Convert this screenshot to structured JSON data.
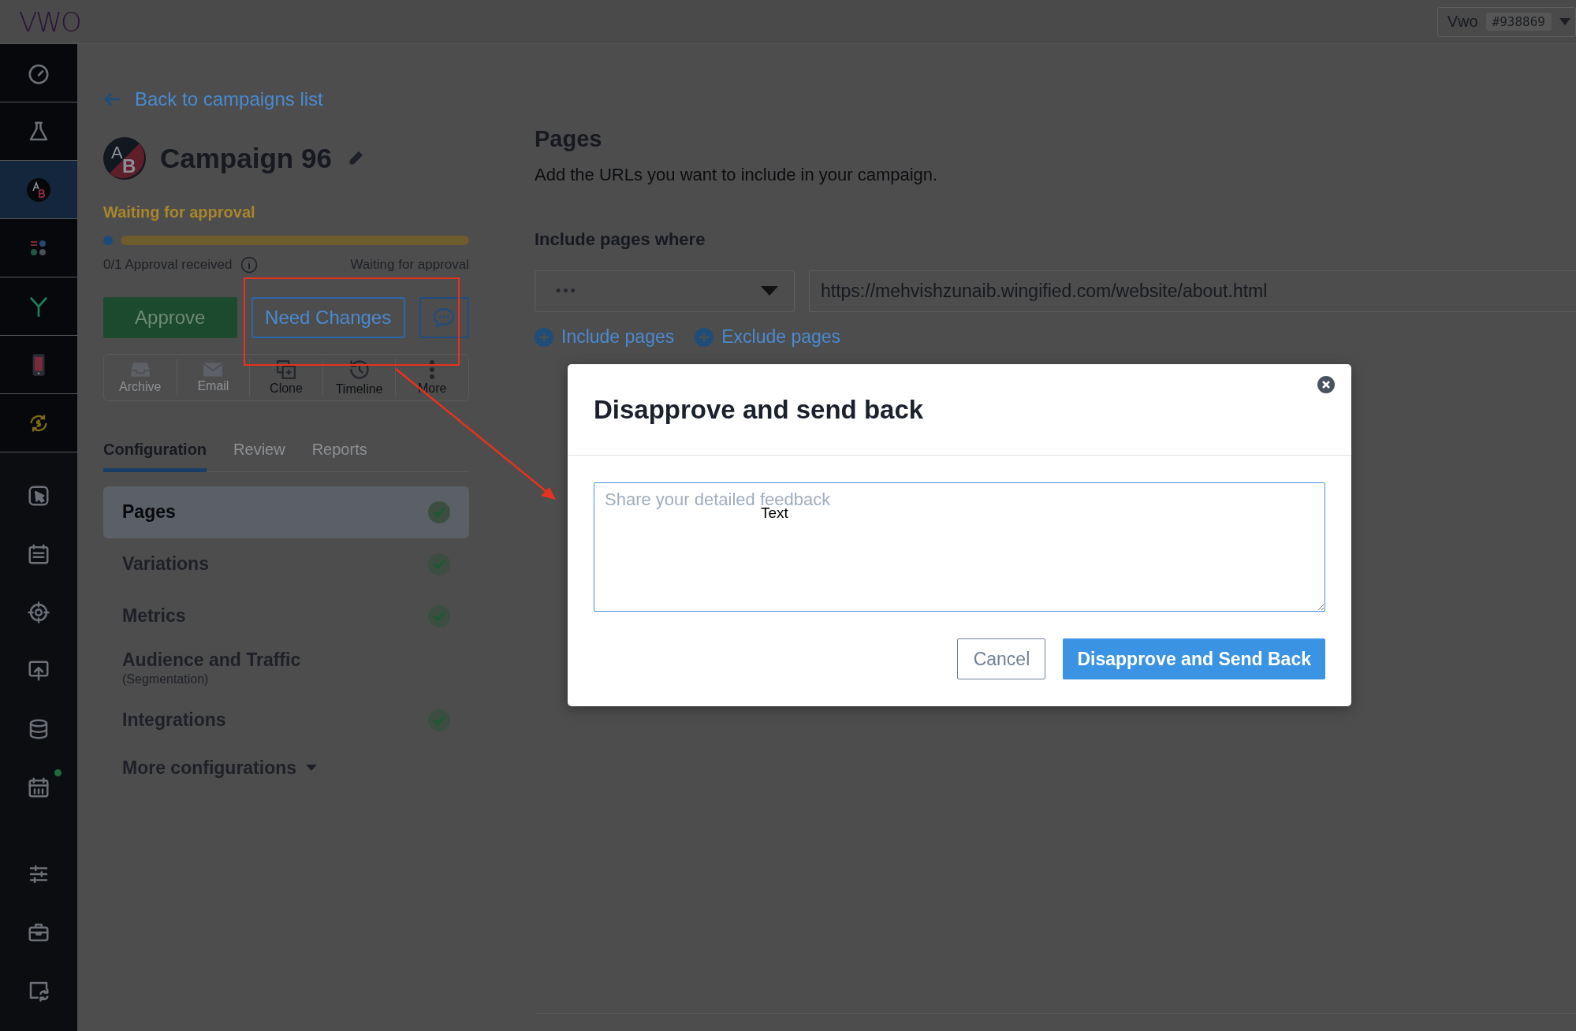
{
  "header": {
    "logo": "VWO",
    "account": {
      "name": "Vwo",
      "id": "#938869"
    }
  },
  "sidebar": {
    "items": [
      {
        "selected": false,
        "notification": false
      },
      {
        "selected": false,
        "notification": false
      },
      {
        "selected": true,
        "notification": false
      },
      {
        "selected": false,
        "notification": false
      },
      {
        "selected": false,
        "notification": false
      },
      {
        "selected": false,
        "notification": false
      },
      {
        "selected": false,
        "notification": false
      },
      {
        "selected": false,
        "notification": false
      },
      {
        "selected": false,
        "notification": false
      },
      {
        "selected": false,
        "notification": false
      },
      {
        "selected": false,
        "notification": false
      },
      {
        "selected": false,
        "notification": false
      },
      {
        "selected": false,
        "notification": true
      },
      {
        "selected": false,
        "notification": false
      },
      {
        "selected": false,
        "notification": false
      },
      {
        "selected": false,
        "notification": false
      }
    ]
  },
  "campaign": {
    "back_link": "Back to campaigns list",
    "avatar": {
      "top": "A",
      "bottom": "B"
    },
    "title": "Campaign 96",
    "status": "Waiting for approval",
    "progress": {
      "level": 1
    },
    "approvals": "0/1 Approval received",
    "approval_status": "Waiting for approval",
    "buttons": {
      "approve": "Approve",
      "need_changes": "Need Changes"
    },
    "actions": [
      {
        "label": "Archive",
        "disabled": true
      },
      {
        "label": "Email",
        "disabled": true
      },
      {
        "label": "Clone",
        "disabled": false
      },
      {
        "label": "Timeline",
        "disabled": false
      },
      {
        "label": "More",
        "disabled": false
      }
    ],
    "tabs": [
      {
        "label": "Configuration",
        "selected": true
      },
      {
        "label": "Review",
        "selected": false
      },
      {
        "label": "Reports",
        "selected": false
      }
    ],
    "config_items": [
      {
        "label": "Pages",
        "selected": true,
        "complete": true
      },
      {
        "label": "Variations",
        "selected": false,
        "complete": true
      },
      {
        "label": "Metrics",
        "selected": false,
        "complete": true
      },
      {
        "label": "Audience and Traffic",
        "sublabel": "(Segmentation)",
        "selected": false,
        "complete": false
      },
      {
        "label": "Integrations",
        "selected": false,
        "complete": true
      }
    ],
    "more": "More configurations"
  },
  "pages": {
    "title": "Pages",
    "description": "Add the URLs you want to include in your campaign.",
    "include_label": "Include pages where",
    "condition": "•••",
    "url": "https://mehvishzunaib.wingified.com/website/about.html",
    "links": [
      "Include pages",
      "Exclude pages"
    ]
  },
  "modal": {
    "title": "Disapprove and send back",
    "placeholder": "Share your detailed feedback",
    "overlay_label": "Text",
    "cancel": "Cancel",
    "confirm": "Disapprove and Send Back"
  }
}
